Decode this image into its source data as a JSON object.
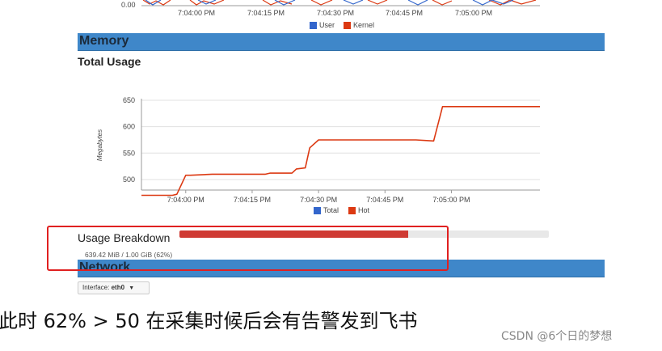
{
  "cpu_chart_fragment": {
    "y_tick": "0.00",
    "x_ticks": [
      "7:04:00 PM",
      "7:04:15 PM",
      "7:04:30 PM",
      "7:04:45 PM",
      "7:05:00 PM"
    ],
    "legend": [
      {
        "label": "User",
        "color": "#3366cc"
      },
      {
        "label": "Kernel",
        "color": "#dc3912"
      }
    ]
  },
  "memory": {
    "section_title": "Memory",
    "chart_title": "Total Usage",
    "legend": [
      {
        "label": "Total",
        "color": "#3366cc"
      },
      {
        "label": "Hot",
        "color": "#dc3912"
      }
    ]
  },
  "chart_data": {
    "type": "line",
    "ylabel": "Megabytes",
    "xlabel": "",
    "ylim": [
      480,
      650
    ],
    "y_ticks": [
      500,
      550,
      600,
      650
    ],
    "x_ticks": [
      "7:04:00 PM",
      "7:04:15 PM",
      "7:04:30 PM",
      "7:04:45 PM",
      "7:05:00 PM"
    ],
    "x": [
      0,
      7,
      8,
      10,
      11,
      16,
      28,
      29,
      34,
      35,
      37,
      38,
      40,
      45,
      52,
      57,
      62,
      66,
      68,
      71,
      84,
      90
    ],
    "series": [
      {
        "name": "Hot",
        "color": "#dc3912",
        "values": [
          470,
          470,
          472,
          508,
          508,
          510,
          510,
          512,
          512,
          520,
          522,
          560,
          575,
          575,
          575,
          575,
          575,
          573,
          638,
          638,
          638,
          638
        ]
      }
    ],
    "grid": true,
    "legend_position": "bottom"
  },
  "usage_breakdown": {
    "label": "Usage Breakdown",
    "detail": "639.42 MiB / 1.00 GiB (62%)",
    "fraction": 0.62,
    "bar_color": "#cf3a33"
  },
  "network": {
    "section_title": "Network",
    "interface_label": "Interface:",
    "interface_value": "eth0"
  },
  "caption": {
    "text": "此时 62% > 50  在采集时候后会有告警发到飞书"
  },
  "watermark": {
    "text": "CSDN @6个日的梦想"
  },
  "highlight_color": "#e02020"
}
